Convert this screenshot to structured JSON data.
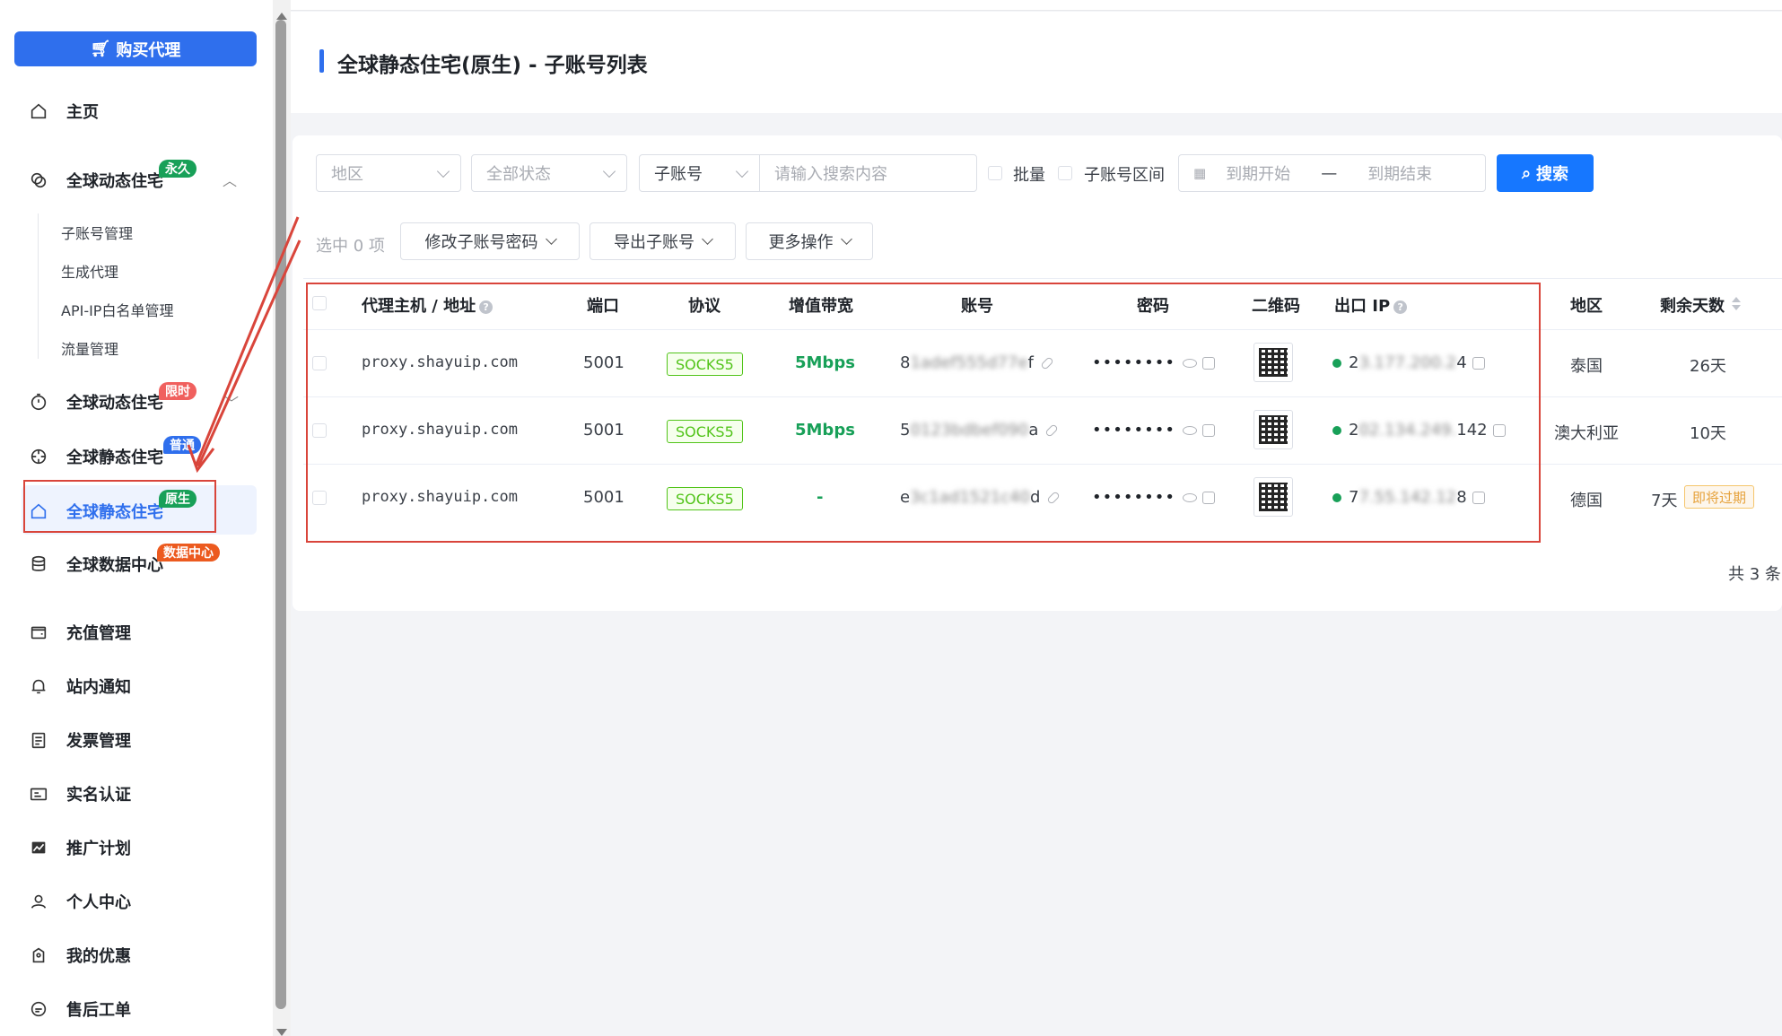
{
  "sidebar": {
    "buy_label": "购买代理",
    "items": [
      {
        "label": "主页",
        "icon": "home-icon"
      },
      {
        "label": "全球动态住宅",
        "badge": "永久",
        "badge_color": "#18a058",
        "expanded": true
      },
      {
        "label": "全球动态住宅",
        "badge": "限时",
        "badge_color": "#f0605e"
      },
      {
        "label": "全球静态住宅",
        "badge": "普通",
        "badge_color": "#2f6fed"
      },
      {
        "label": "全球静态住宅",
        "badge": "原生",
        "badge_color": "#18a058",
        "active": true
      },
      {
        "label": "全球数据中心",
        "badge": "数据中心",
        "badge_color": "#ec5a1f"
      },
      {
        "label": "充值管理"
      },
      {
        "label": "站内通知"
      },
      {
        "label": "发票管理"
      },
      {
        "label": "实名认证"
      },
      {
        "label": "推广计划"
      },
      {
        "label": "个人中心"
      },
      {
        "label": "我的优惠"
      },
      {
        "label": "售后工单"
      }
    ],
    "subitems": [
      "子账号管理",
      "生成代理",
      "API-IP白名单管理",
      "流量管理"
    ]
  },
  "header": {
    "title": "全球静态住宅(原生) - 子账号列表"
  },
  "filters": {
    "region_placeholder": "地区",
    "status_placeholder": "全部状态",
    "field_select": "子账号",
    "search_placeholder": "请输入搜索内容",
    "batch_label": "批量",
    "range_label": "子账号区间",
    "start_placeholder": "到期开始",
    "separator": "—",
    "end_placeholder": "到期结束",
    "search_button": "搜索"
  },
  "actions": {
    "selected": "选中 0 项",
    "change_pwd": "修改子账号密码",
    "export": "导出子账号",
    "more": "更多操作"
  },
  "table": {
    "columns": [
      "代理主机 / 地址",
      "端口",
      "协议",
      "增值带宽",
      "账号",
      "密码",
      "二维码",
      "出口 IP",
      "地区",
      "剩余天数"
    ],
    "rows": [
      {
        "host": "proxy.shayuip.com",
        "port": "5001",
        "protocol": "SOCKS5",
        "bandwidth": "5Mbps",
        "account_pre": "8",
        "account_blur": "1adef555d77e",
        "account_post": "f",
        "password": "••••••••",
        "ip_pre": "2",
        "ip_blur": "3.177.200.2",
        "ip_post": "4",
        "region": "泰国",
        "days": "26天",
        "tag": ""
      },
      {
        "host": "proxy.shayuip.com",
        "port": "5001",
        "protocol": "SOCKS5",
        "bandwidth": "5Mbps",
        "account_pre": "5",
        "account_blur": "0123bdbef090",
        "account_post": "a",
        "password": "••••••••",
        "ip_pre": "2",
        "ip_blur": "02.134.249.",
        "ip_post": "142",
        "region": "澳大利亚",
        "days": "10天",
        "tag": ""
      },
      {
        "host": "proxy.shayuip.com",
        "port": "5001",
        "protocol": "SOCKS5",
        "bandwidth": "-",
        "account_pre": "e",
        "account_blur": "3c1ad1521c40",
        "account_post": "d",
        "password": "••••••••",
        "ip_pre": "7",
        "ip_blur": "7.55.142.12",
        "ip_post": "8",
        "region": "德国",
        "days": "7天",
        "tag": "即将过期"
      }
    ]
  },
  "total": "共 3 条"
}
